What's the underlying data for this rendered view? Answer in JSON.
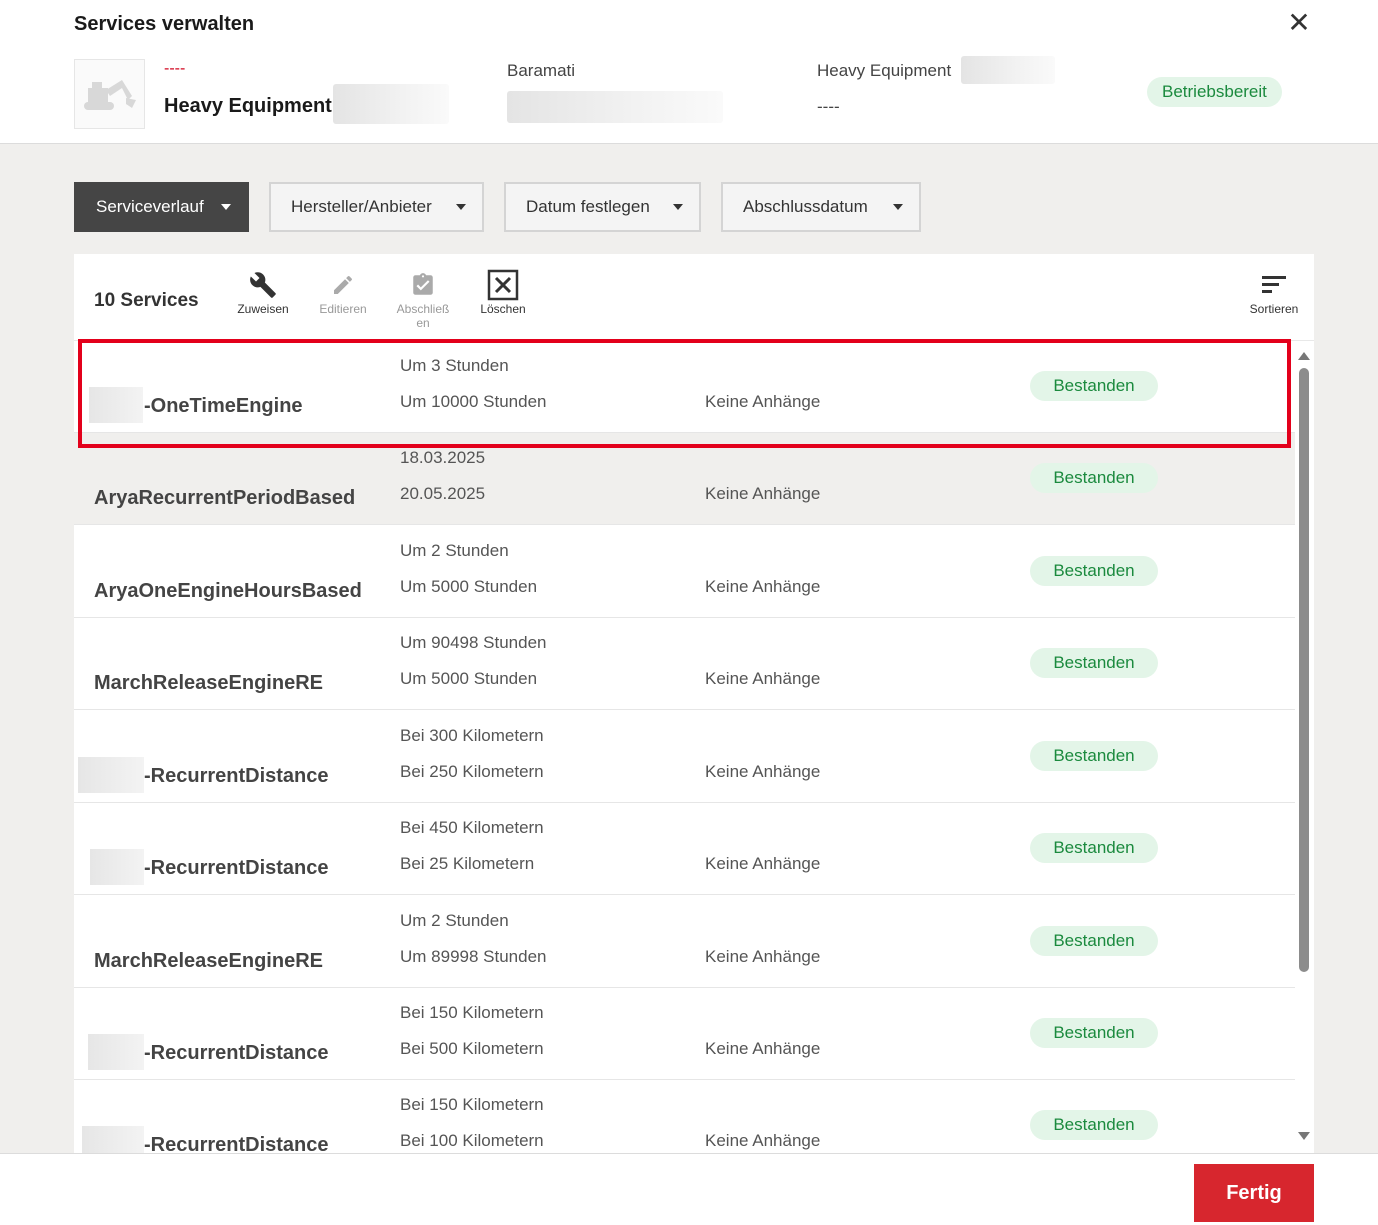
{
  "header": {
    "title": "Services verwalten",
    "asset_id": "----",
    "asset_name": "Heavy Equipment",
    "location": "Baramati",
    "category": "Heavy Equipment",
    "category_value": "----",
    "status": "Betriebsbereit"
  },
  "filters": [
    {
      "label": "Serviceverlauf",
      "active": true
    },
    {
      "label": "Hersteller/Anbieter"
    },
    {
      "label": "Datum festlegen"
    },
    {
      "label": "Abschlussdatum"
    }
  ],
  "toolbar": {
    "count": "10 Services",
    "assign": "Zuweisen",
    "edit": "Editieren",
    "complete": "Abschließ en",
    "delete": "Löschen",
    "sort": "Sortieren"
  },
  "services": [
    {
      "name": "-OneTimeEngine",
      "line1": "Um 3 Stunden",
      "line2": "Um 10000 Stunden",
      "attachments": "Keine Anhänge",
      "status": "Bestanden"
    },
    {
      "name": "AryaRecurrentPeriodBased",
      "line1": "18.03.2025",
      "line2": "20.05.2025",
      "attachments": "Keine Anhänge",
      "status": "Bestanden"
    },
    {
      "name": "AryaOneEngineHoursBased",
      "line1": "Um 2 Stunden",
      "line2": "Um 5000 Stunden",
      "attachments": "Keine Anhänge",
      "status": "Bestanden"
    },
    {
      "name": "MarchReleaseEngineRE",
      "line1": "Um 90498 Stunden",
      "line2": "Um 5000 Stunden",
      "attachments": "Keine Anhänge",
      "status": "Bestanden"
    },
    {
      "name": "-RecurrentDistance",
      "line1": "Bei 300 Kilometern",
      "line2": "Bei 250 Kilometern",
      "attachments": "Keine Anhänge",
      "status": "Bestanden"
    },
    {
      "name": "-RecurrentDistance",
      "line1": "Bei 450 Kilometern",
      "line2": "Bei 25 Kilometern",
      "attachments": "Keine Anhänge",
      "status": "Bestanden"
    },
    {
      "name": "MarchReleaseEngineRE",
      "line1": "Um 2 Stunden",
      "line2": "Um 89998 Stunden",
      "attachments": "Keine Anhänge",
      "status": "Bestanden"
    },
    {
      "name": "-RecurrentDistance",
      "line1": "Bei 150 Kilometern",
      "line2": "Bei 500 Kilometern",
      "attachments": "Keine Anhänge",
      "status": "Bestanden"
    },
    {
      "name": "-RecurrentDistance",
      "line1": "Bei 150 Kilometern",
      "line2": "Bei 100 Kilometern",
      "attachments": "Keine Anhänge",
      "status": "Bestanden"
    }
  ],
  "footer": {
    "done": "Fertig"
  }
}
